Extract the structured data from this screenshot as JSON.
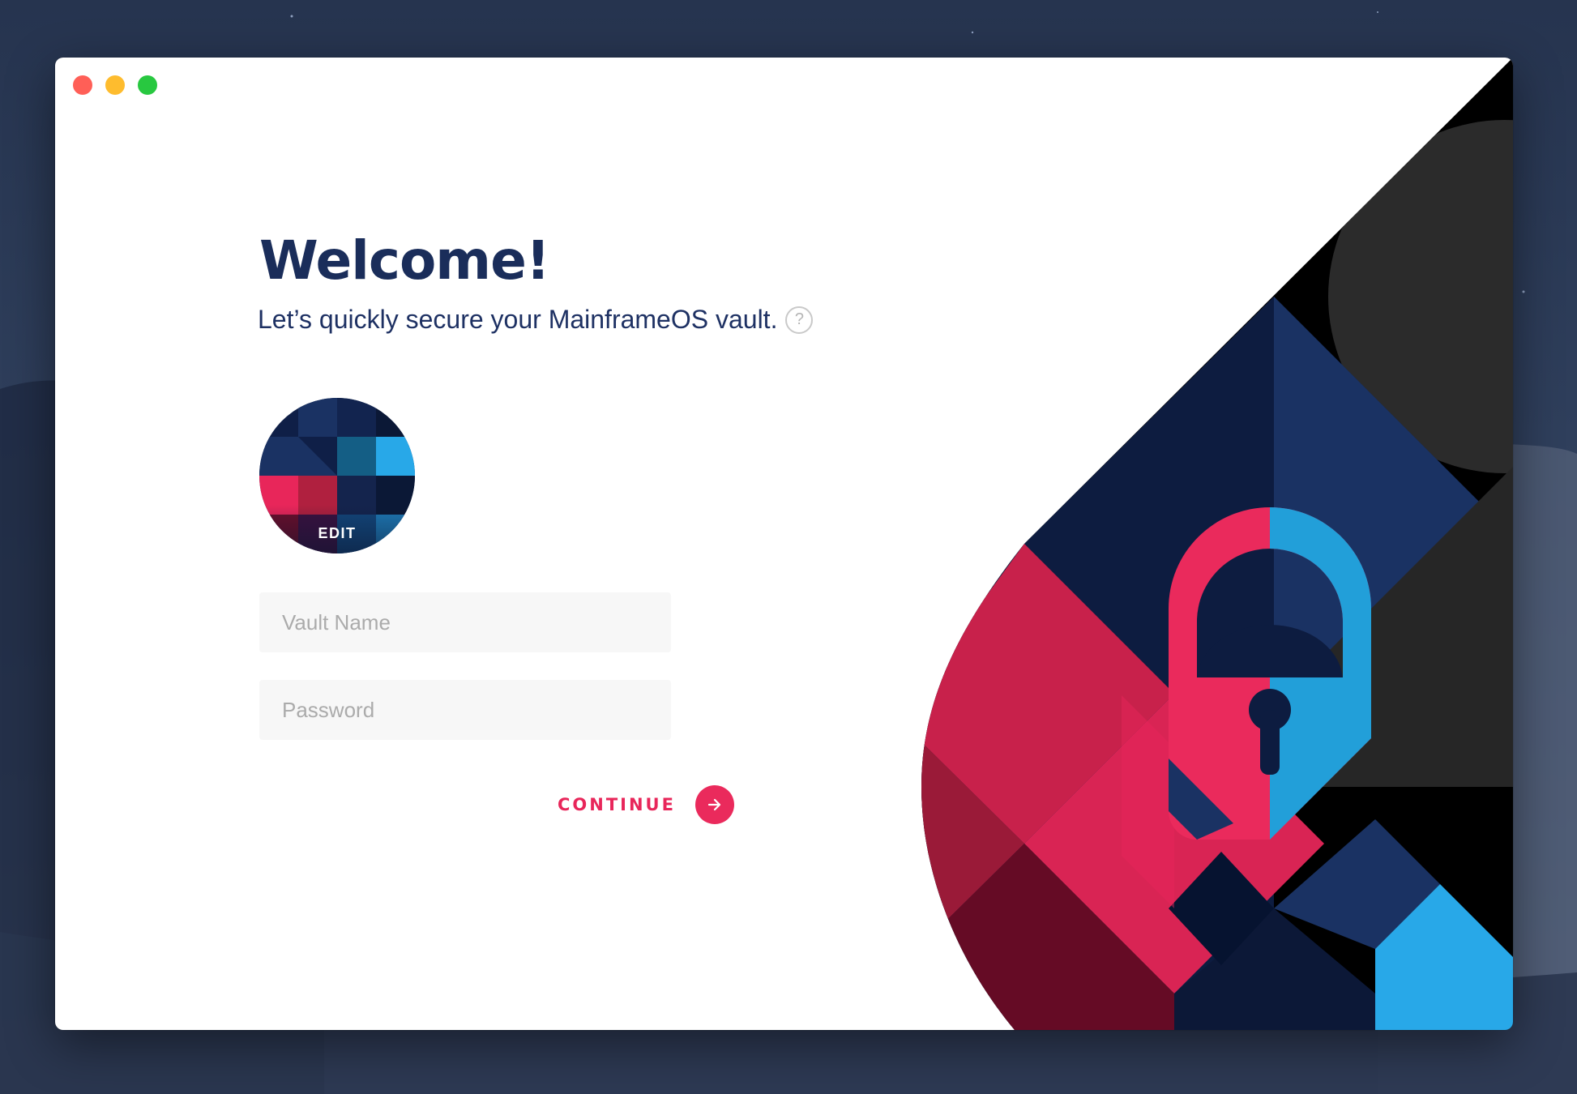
{
  "window": {
    "controls": [
      {
        "name": "close",
        "color": "#ff5f57"
      },
      {
        "name": "minimize",
        "color": "#febc2e"
      },
      {
        "name": "zoom",
        "color": "#28c840"
      }
    ]
  },
  "welcome": {
    "title": "Welcome!",
    "subtitle": "Let’s quickly secure your MainframeOS vault.",
    "help_icon": "?"
  },
  "avatar": {
    "edit_label": "EDIT"
  },
  "form": {
    "vault_name_placeholder": "Vault Name",
    "password_placeholder": "Password"
  },
  "actions": {
    "continue_label": "CONTINUE",
    "continue_icon": "arrow-right-icon"
  },
  "colors": {
    "brand_navy": "#1a2d5a",
    "accent_pink": "#e8265a",
    "accent_blue": "#28a8e8"
  }
}
